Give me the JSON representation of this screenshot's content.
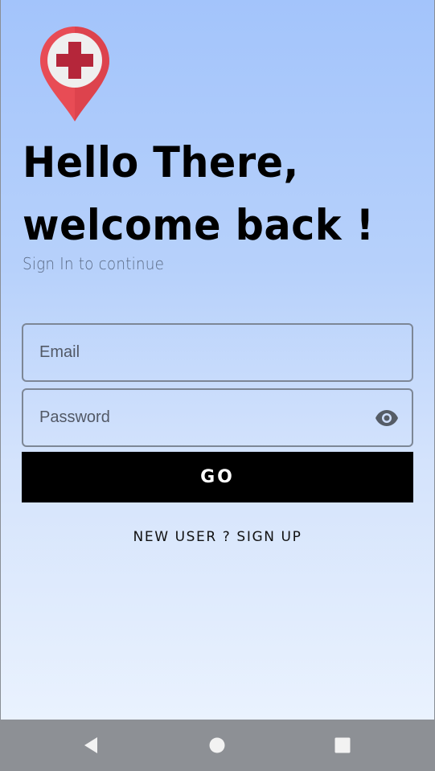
{
  "app": {
    "logo_icon": "medical-location-pin-icon",
    "brand_colors": {
      "pin": "#e84c55",
      "cross": "#b5263a",
      "inner": "#f0f0f0"
    }
  },
  "header": {
    "headline_line1": "Hello There,",
    "headline_line2": "welcome back !",
    "subtitle": "Sign In to continue"
  },
  "form": {
    "email_placeholder": "Email",
    "email_value": "",
    "password_placeholder": "Password",
    "password_value": "",
    "password_toggle_icon": "eye-icon",
    "submit_label": "GO"
  },
  "footer": {
    "signup_label": "NEW USER ? SIGN UP"
  },
  "system_nav": {
    "back_icon": "back-triangle-icon",
    "home_icon": "home-circle-icon",
    "recents_icon": "recents-square-icon"
  }
}
